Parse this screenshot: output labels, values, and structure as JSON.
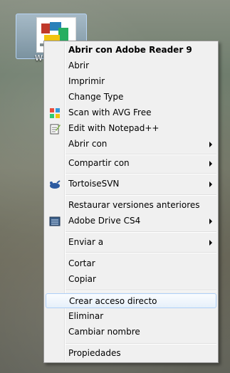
{
  "desktop": {
    "icon_label": "W"
  },
  "menu": {
    "items": [
      {
        "label": "Abrir con Adobe Reader 9",
        "bold": true
      },
      {
        "label": "Abrir"
      },
      {
        "label": "Imprimir"
      },
      {
        "label": "Change Type"
      },
      {
        "label": "Scan with AVG Free",
        "icon": "avg-icon"
      },
      {
        "label": "Edit with Notepad++",
        "icon": "notepad-icon"
      },
      {
        "label": "Abrir con",
        "submenu": true
      },
      {
        "label": "Compartir con",
        "submenu": true
      },
      {
        "label": "TortoiseSVN",
        "icon": "tortoise-icon",
        "submenu": true
      },
      {
        "label": "Restaurar versiones anteriores"
      },
      {
        "label": "Adobe Drive CS4",
        "icon": "adobe-drive-icon",
        "submenu": true
      },
      {
        "label": "Enviar a",
        "submenu": true
      },
      {
        "label": "Cortar"
      },
      {
        "label": "Copiar"
      },
      {
        "label": "Crear acceso directo",
        "highlighted": true
      },
      {
        "label": "Eliminar"
      },
      {
        "label": "Cambiar nombre"
      },
      {
        "label": "Propiedades"
      }
    ]
  }
}
